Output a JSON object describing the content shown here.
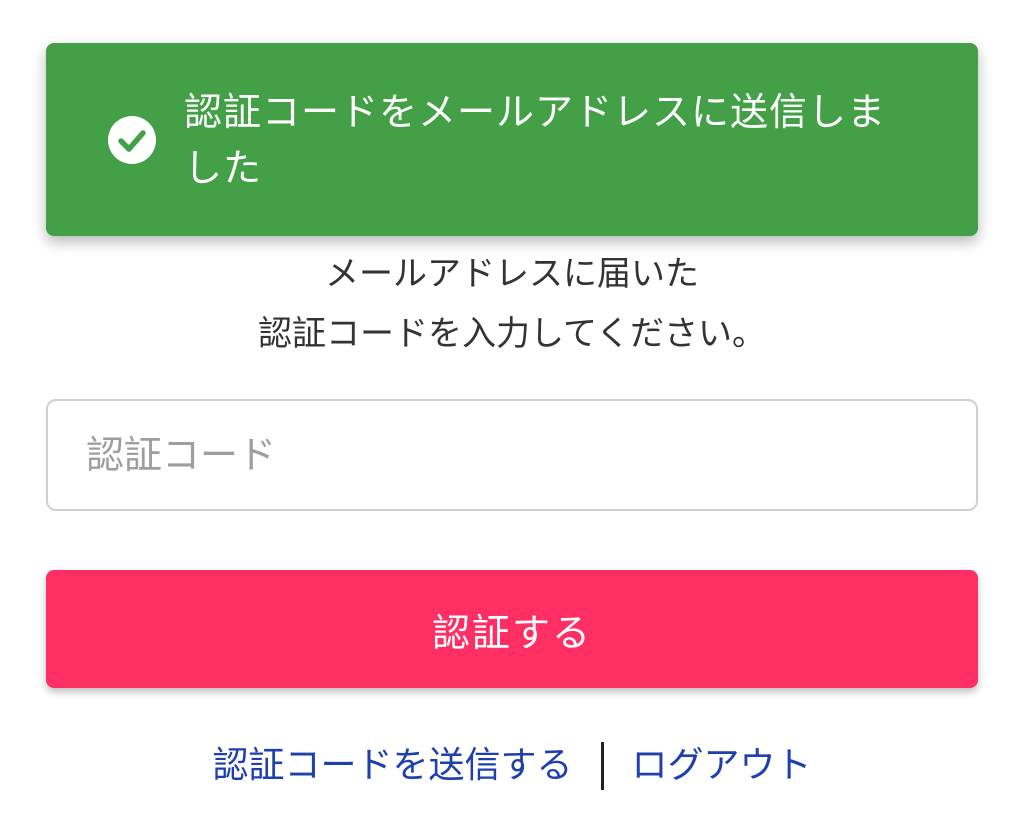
{
  "toast": {
    "icon": "check-circle-icon",
    "message": "認証コードをメールアドレスに送信しました",
    "color": "#43a047"
  },
  "instruction": {
    "line1": "メールアドレスに届いた",
    "line2": "認証コードを入力してください。"
  },
  "code_input": {
    "placeholder": "認証コード",
    "value": ""
  },
  "submit": {
    "label": "認証する",
    "color": "#ff2e63"
  },
  "footer": {
    "resend_label": "認証コードを送信する",
    "logout_label": "ログアウト",
    "link_color": "#1e3fae"
  }
}
